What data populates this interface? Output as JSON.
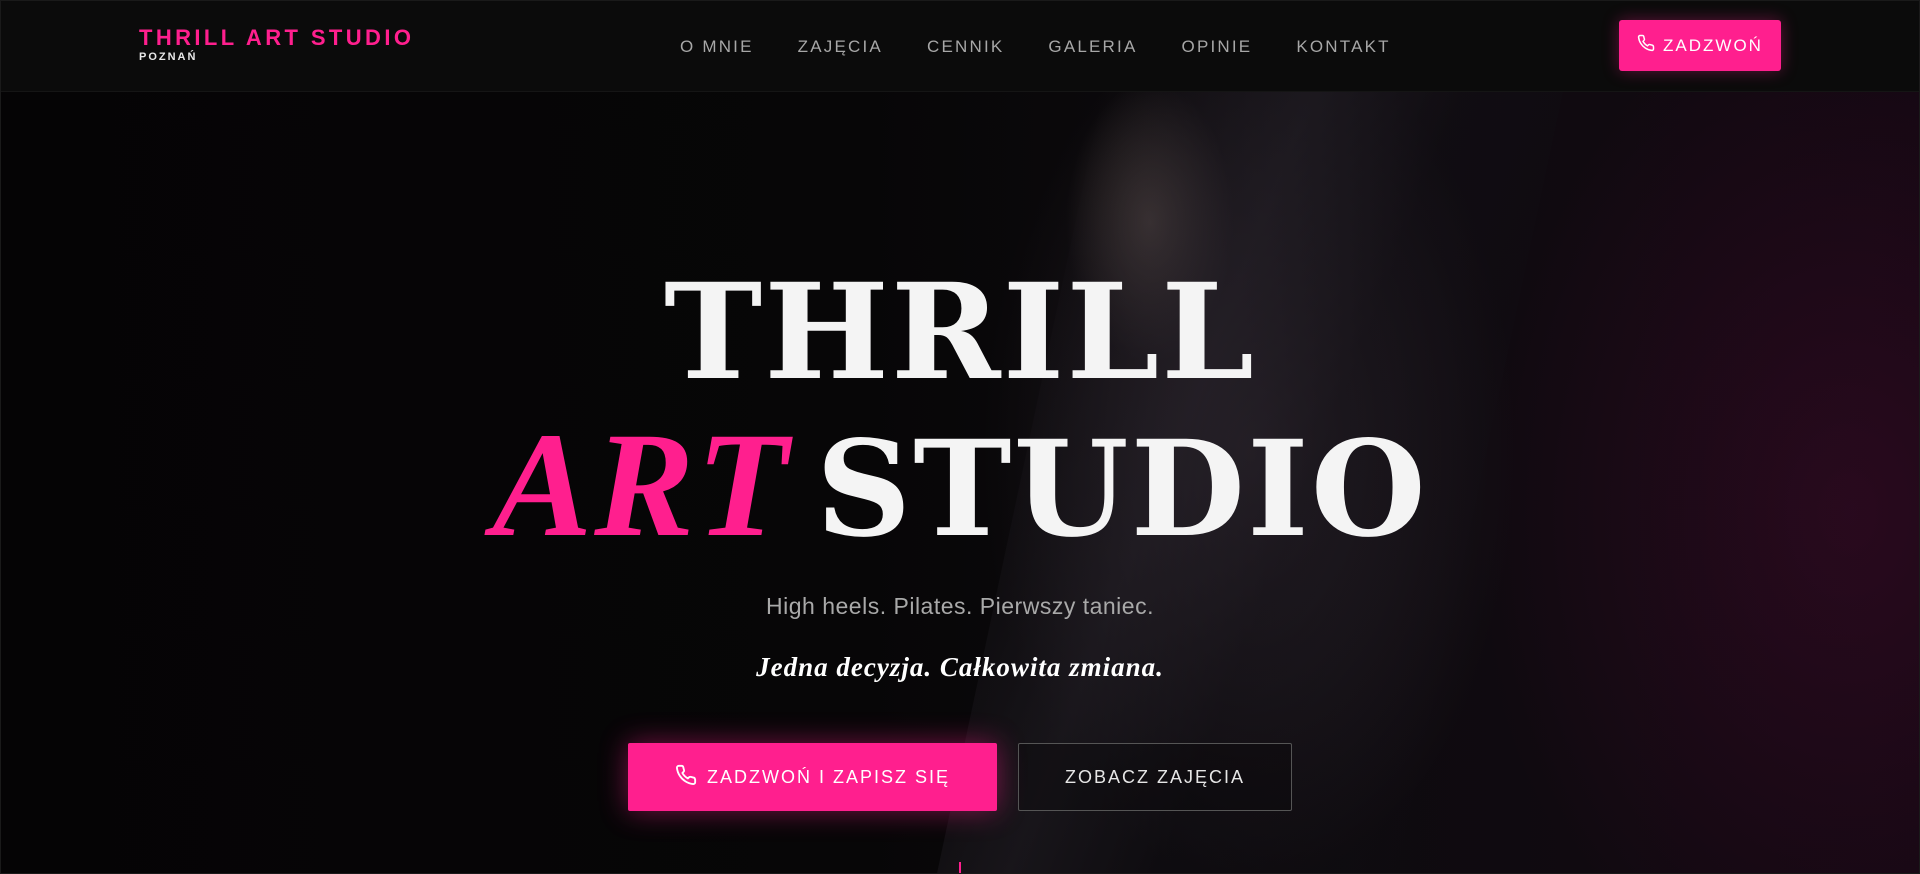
{
  "header": {
    "logo_title": "THRILL ART STUDIO",
    "logo_subtitle": "POZNAŃ",
    "nav": [
      {
        "label": "O MNIE"
      },
      {
        "label": "ZAJĘCIA"
      },
      {
        "label": "CENNIK"
      },
      {
        "label": "GALERIA"
      },
      {
        "label": "OPINIE"
      },
      {
        "label": "KONTAKT"
      }
    ],
    "call_button": {
      "label": "ZADZWOŃ",
      "icon": "phone-icon"
    }
  },
  "hero": {
    "title_line1": "THRILL",
    "title_art": "ART",
    "title_studio": "STUDIO",
    "subtitle": "High heels. Pilates. Pierwszy taniec.",
    "tagline": "Jedna decyzja. Całkowita zmiana.",
    "cta_primary": {
      "label": "ZADZWOŃ I ZAPISZ SIĘ",
      "icon": "phone-icon"
    },
    "cta_secondary": {
      "label": "ZOBACZ ZAJĘCIA"
    }
  },
  "colors": {
    "accent": "#ff1f8e",
    "background": "#060507",
    "header_bg": "#0b0b0b",
    "text_primary": "#f4f4f4",
    "text_muted": "#a9a9a9"
  }
}
